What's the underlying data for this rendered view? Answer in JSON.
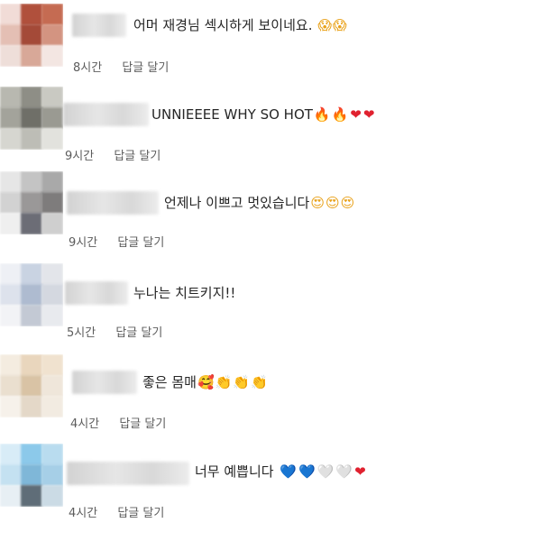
{
  "comments": [
    {
      "text": "어머 재경님 섹시하게 보이네요.",
      "emoji": [
        "😱",
        "😱"
      ],
      "time": "8시간",
      "reply_label": "답글 달기",
      "avatar_colors": [
        "#f1dcd7",
        "#b0503c",
        "#c56b52",
        "#e4bfb4",
        "#a44a38",
        "#d39481",
        "#eeded9",
        "#d8a898",
        "#f3e6e2"
      ]
    },
    {
      "text": "UNNIEEEE WHY SO HOT",
      "emoji": [
        "🔥",
        "🔥",
        "❤",
        "❤"
      ],
      "time": "9시간",
      "reply_label": "답글 달기",
      "avatar_colors": [
        "#b8b8b0",
        "#8e8e86",
        "#c9c9c2",
        "#a3a39b",
        "#6f6f68",
        "#9a9a92",
        "#d6d6d0",
        "#bdbdb6",
        "#e2e2dd"
      ]
    },
    {
      "text": "언제나 이쁘고 멋있습니다",
      "emoji": [
        "😍",
        "😍",
        "😍"
      ],
      "time": "9시간",
      "reply_label": "답글 달기",
      "avatar_colors": [
        "#e6e6e6",
        "#c4c4c4",
        "#a9a9a9",
        "#d2d2d2",
        "#9a9898",
        "#7e7c7c",
        "#efefef",
        "#6c6d76",
        "#cfcfcf"
      ]
    },
    {
      "text": "누나는 치트키지!!",
      "emoji": [],
      "time": "5시간",
      "reply_label": "답글 달기",
      "avatar_colors": [
        "#eef0f5",
        "#c9d3e2",
        "#e3e5ea",
        "#dde2ec",
        "#aebbd0",
        "#d4d8e0",
        "#f2f3f6",
        "#c3c9d4",
        "#e8eaee"
      ]
    },
    {
      "text": "좋은 몸매",
      "emoji": [
        "🥰",
        "👏",
        "👏",
        "👏"
      ],
      "time": "4시간",
      "reply_label": "답글 달기",
      "avatar_colors": [
        "#f4ece0",
        "#e9d6bd",
        "#f0e2cf",
        "#eadfcf",
        "#d9c3a5",
        "#efe6da",
        "#f6f1ea",
        "#e4d8c8",
        "#f2ebe1"
      ]
    },
    {
      "text": "너무 예쁩니다",
      "emoji": [
        "💙",
        "💙",
        "🤍",
        "🤍",
        "❤"
      ],
      "time": "4시간",
      "reply_label": "답글 달기",
      "avatar_colors": [
        "#d8ecf7",
        "#8cc9ea",
        "#b9dcef",
        "#c4e1f1",
        "#7fb7d8",
        "#a6cfe7",
        "#e7eff4",
        "#5f6d78",
        "#cbdbe5"
      ]
    }
  ]
}
